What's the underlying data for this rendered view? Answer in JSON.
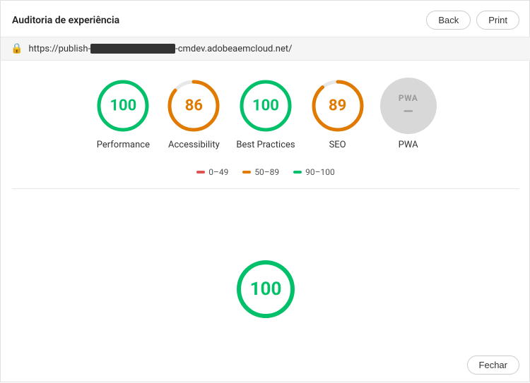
{
  "header": {
    "title": "Auditoria de experiência",
    "back_label": "Back",
    "print_label": "Print"
  },
  "url_bar": {
    "url_prefix": "https://publish-",
    "url_suffix": "-cmdev.adobeaemcloud.net/"
  },
  "scores": [
    {
      "id": "performance",
      "value": "100",
      "label": "Performance",
      "color": "green",
      "stroke_color": "#00c06a",
      "percentage": 100
    },
    {
      "id": "accessibility",
      "value": "86",
      "label": "Accessibility",
      "color": "orange",
      "stroke_color": "#e07b00",
      "percentage": 86
    },
    {
      "id": "best-practices",
      "value": "100",
      "label": "Best Practices",
      "color": "green",
      "stroke_color": "#00c06a",
      "percentage": 100
    },
    {
      "id": "seo",
      "value": "89",
      "label": "SEO",
      "color": "orange",
      "stroke_color": "#e07b00",
      "percentage": 89
    }
  ],
  "pwa": {
    "label": "PWA",
    "circle_label": "PWA"
  },
  "legend": [
    {
      "range": "0–49",
      "color": "red"
    },
    {
      "range": "50–89",
      "color": "orange"
    },
    {
      "range": "90–100",
      "color": "green"
    }
  ],
  "bottom_score": {
    "value": "100",
    "percentage": 100,
    "stroke_color": "#00c06a"
  },
  "footer": {
    "close_label": "Fechar"
  }
}
